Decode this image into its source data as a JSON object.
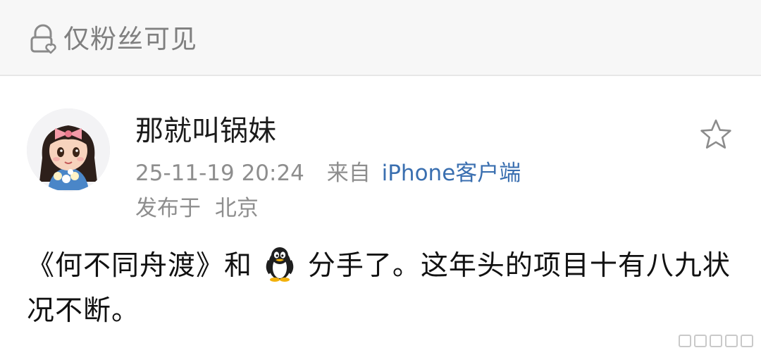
{
  "visibility": {
    "label": "仅粉丝可见",
    "icon": "lock-heart-icon"
  },
  "author": {
    "name": "那就叫锅妹",
    "avatar": "cartoon-girl-avatar"
  },
  "meta": {
    "time": "25-11-19 20:24",
    "from_label": "来自",
    "client": "iPhone客户端"
  },
  "location": {
    "prefix": "发布于",
    "city": "北京"
  },
  "post": {
    "part1": "《何不同舟渡》和",
    "emoji": "penguin-icon",
    "part2": "分手了。这年头的项目十有八九状况不断。"
  },
  "actions": {
    "favorite_icon": "star-icon"
  },
  "colors": {
    "link": "#3a6fb0",
    "muted": "#8e8e8e",
    "topbar_bg": "#f7f7f7"
  }
}
